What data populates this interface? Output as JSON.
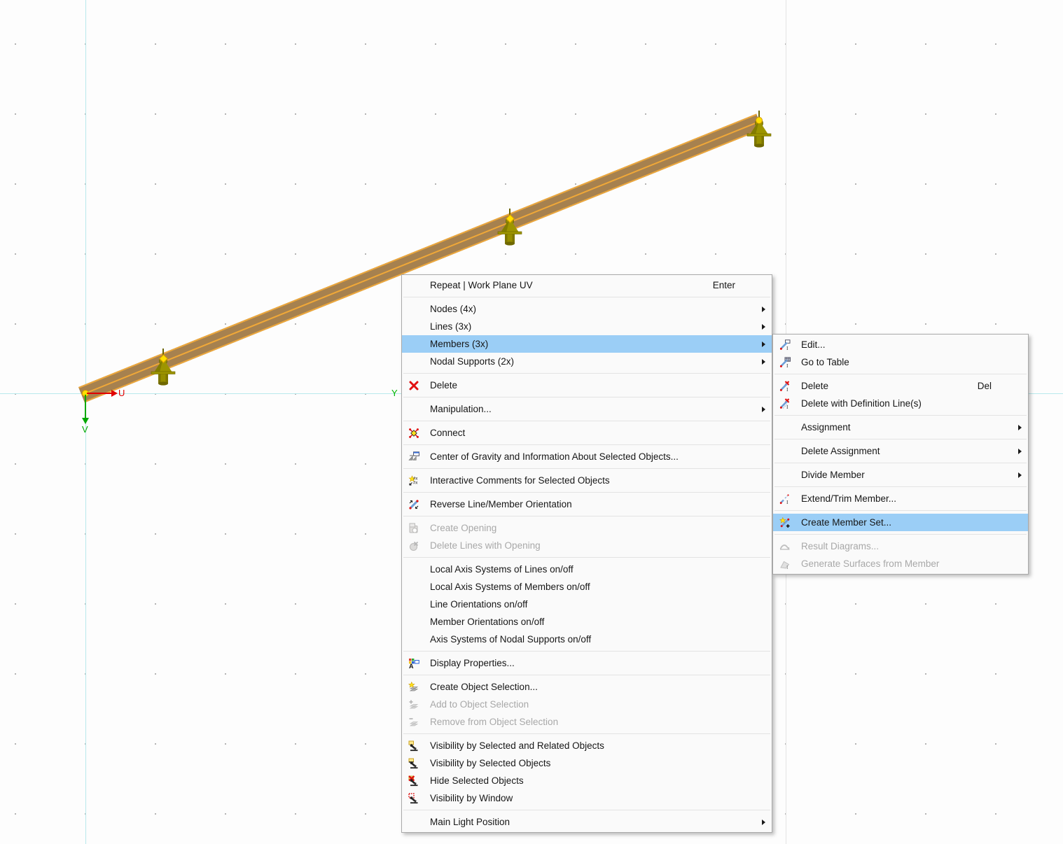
{
  "workspace": {
    "axes": {
      "u_label": "U",
      "v_label": "V",
      "y_label": "Y"
    },
    "colors": {
      "member_fill": "#a6814f",
      "selection_outline": "#f0a838",
      "support": "#9d9500",
      "node": "#ffdf00",
      "menu_highlight": "#9bcef6",
      "axis_u": "#e00000",
      "axis_v": "#00a800"
    }
  },
  "context_menu": {
    "items": [
      {
        "type": "item",
        "label": "Repeat | Work Plane UV",
        "shortcut": "Enter"
      },
      {
        "type": "separator"
      },
      {
        "type": "item",
        "label": "Nodes (4x)",
        "submenu": true
      },
      {
        "type": "item",
        "label": "Lines (3x)",
        "submenu": true
      },
      {
        "type": "item",
        "label": "Members (3x)",
        "submenu": true,
        "highlighted": true
      },
      {
        "type": "item",
        "label": "Nodal Supports (2x)",
        "submenu": true
      },
      {
        "type": "separator"
      },
      {
        "type": "item",
        "label": "Delete",
        "icon": "delete-icon"
      },
      {
        "type": "separator"
      },
      {
        "type": "item",
        "label": "Manipulation...",
        "submenu": true
      },
      {
        "type": "separator"
      },
      {
        "type": "item",
        "label": "Connect",
        "icon": "connect-icon"
      },
      {
        "type": "separator"
      },
      {
        "type": "item",
        "label": "Center of Gravity and Information About Selected Objects...",
        "icon": "center-of-gravity-icon"
      },
      {
        "type": "separator"
      },
      {
        "type": "item",
        "label": "Interactive Comments for Selected Objects",
        "icon": "interactive-comments-icon"
      },
      {
        "type": "separator"
      },
      {
        "type": "item",
        "label": "Reverse Line/Member Orientation",
        "icon": "reverse-orientation-icon"
      },
      {
        "type": "separator"
      },
      {
        "type": "item",
        "label": "Create Opening",
        "icon": "create-opening-icon",
        "disabled": true
      },
      {
        "type": "item",
        "label": "Delete Lines with Opening",
        "icon": "delete-opening-icon",
        "disabled": true
      },
      {
        "type": "separator"
      },
      {
        "type": "item",
        "label": "Local Axis Systems of Lines on/off"
      },
      {
        "type": "item",
        "label": "Local Axis Systems of Members on/off"
      },
      {
        "type": "item",
        "label": "Line Orientations on/off"
      },
      {
        "type": "item",
        "label": "Member Orientations on/off"
      },
      {
        "type": "item",
        "label": "Axis Systems of Nodal Supports on/off"
      },
      {
        "type": "separator"
      },
      {
        "type": "item",
        "label": "Display Properties...",
        "icon": "display-properties-icon"
      },
      {
        "type": "separator"
      },
      {
        "type": "item",
        "label": "Create Object Selection...",
        "icon": "create-object-selection-icon"
      },
      {
        "type": "item",
        "label": "Add to Object Selection",
        "icon": "add-object-selection-icon",
        "disabled": true
      },
      {
        "type": "item",
        "label": "Remove from Object Selection",
        "icon": "remove-object-selection-icon",
        "disabled": true
      },
      {
        "type": "separator"
      },
      {
        "type": "item",
        "label": "Visibility by Selected and Related Objects",
        "icon": "visibility-related-icon"
      },
      {
        "type": "item",
        "label": "Visibility by Selected Objects",
        "icon": "visibility-selected-icon"
      },
      {
        "type": "item",
        "label": "Hide Selected Objects",
        "icon": "hide-selected-icon"
      },
      {
        "type": "item",
        "label": "Visibility by Window",
        "icon": "visibility-window-icon"
      },
      {
        "type": "separator"
      },
      {
        "type": "item",
        "label": "Main Light Position",
        "submenu": true
      }
    ]
  },
  "submenu": {
    "items": [
      {
        "type": "item",
        "label": "Edit...",
        "icon": "edit-icon"
      },
      {
        "type": "item",
        "label": "Go to Table",
        "icon": "go-to-table-icon"
      },
      {
        "type": "separator"
      },
      {
        "type": "item",
        "label": "Delete",
        "icon": "member-delete-icon",
        "shortcut": "Del"
      },
      {
        "type": "item",
        "label": "Delete with Definition Line(s)",
        "icon": "member-delete-line-icon"
      },
      {
        "type": "separator"
      },
      {
        "type": "item",
        "label": "Assignment",
        "submenu": true
      },
      {
        "type": "separator"
      },
      {
        "type": "item",
        "label": "Delete Assignment",
        "submenu": true
      },
      {
        "type": "separator"
      },
      {
        "type": "item",
        "label": "Divide Member",
        "submenu": true
      },
      {
        "type": "separator"
      },
      {
        "type": "item",
        "label": "Extend/Trim Member...",
        "icon": "extend-trim-icon"
      },
      {
        "type": "separator"
      },
      {
        "type": "item",
        "label": "Create Member Set...",
        "icon": "create-member-set-icon",
        "highlighted": true
      },
      {
        "type": "separator"
      },
      {
        "type": "item",
        "label": "Result Diagrams...",
        "icon": "result-diagrams-icon",
        "disabled": true
      },
      {
        "type": "item",
        "label": "Generate Surfaces from Member",
        "icon": "generate-surfaces-icon",
        "disabled": true
      }
    ]
  }
}
